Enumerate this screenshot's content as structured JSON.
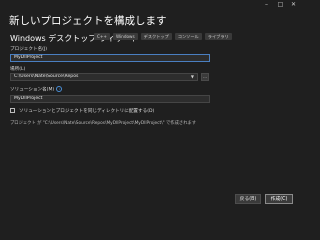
{
  "window": {
    "controls": {
      "minimize": "–",
      "maximize": "□",
      "close": "✕"
    }
  },
  "heading": "新しいプロジェクトを構成します",
  "subtitle": "Windows デスクトップ ウィザード",
  "tags": [
    "C++",
    "Windows",
    "デスクトップ",
    "コンソール",
    "ライブラリ"
  ],
  "form": {
    "project_name_label": "プロジェクト名(J)",
    "project_name_value": "MyDllProject",
    "location_label": "場所(L)",
    "location_value": "C:\\Users\\Nate\\Source\\Repos",
    "location_dropdown_icon": "chevron-down-icon",
    "browse_label": "...",
    "solution_name_label": "ソリューション名(M)",
    "solution_name_value": "MyDllProject",
    "info_icon": "info-icon",
    "same_dir_label": "ソリューションとプロジェクトを同じディレクトリに配置する(D)",
    "same_dir_checked": false,
    "path_note": "プロジェクト が \"C:\\Users\\Nate\\Source\\Repos\\MyDllProject\\MyDllProject\\\" で作成されます"
  },
  "footer": {
    "back_label": "戻る(B)",
    "create_label": "作成(C)"
  },
  "colors": {
    "background": "#1f1f1f",
    "field_bg": "#2d2d2d",
    "focus_border": "#4a7fc1",
    "tag_bg": "#3a3a3a"
  }
}
